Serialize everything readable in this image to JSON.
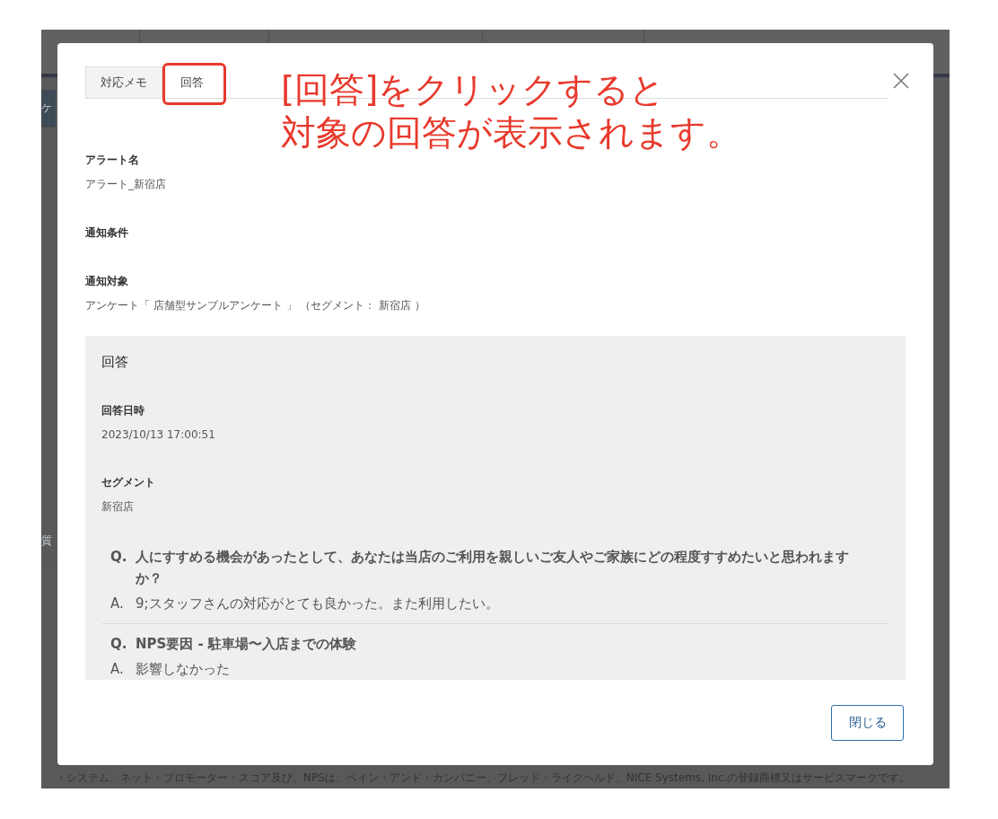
{
  "background_app": {
    "sidebar_items": [
      "ケ",
      "質"
    ],
    "footer": "・システム、ネット・プロモーター・スコア及び、NPSは、ベイン・アンド・カンパニー、フレッド・ライクヘルド、NICE Systems, Inc.の登録商標又はサービスマークです。"
  },
  "annotation": {
    "lines": [
      "[回答]をクリックすると",
      "対象の回答が表示されます。"
    ]
  },
  "modal": {
    "tabs": [
      {
        "label": "対応メモ",
        "selected": false,
        "highlighted": false
      },
      {
        "label": "回答",
        "selected": true,
        "highlighted": true
      }
    ],
    "fields": [
      {
        "label": "アラート名",
        "value": "アラート_新宿店"
      },
      {
        "label": "通知条件"
      },
      {
        "label": "通知対象",
        "value": "アンケート「 店舗型サンプルアンケート 」 （セグメント： 新宿店 ）"
      }
    ],
    "answer_panel": {
      "title": "回答",
      "fields": [
        {
          "label": "回答日時",
          "value": "2023/10/13 17:00:51"
        },
        {
          "label": "セグメント",
          "value": "新宿店"
        }
      ],
      "qa": [
        {
          "question_mark": "Q.",
          "question": "人にすすめる機会があったとして、あなたは当店のご利用を親しいご友人やご家族にどの程度すすめたいと思われますか？",
          "answer_mark": "A.",
          "answer": "9;スタッフさんの対応がとても良かった。また利用したい。"
        },
        {
          "question_mark": "Q.",
          "question": "NPS要因 - 駐車場〜入店までの体験",
          "answer_mark": "A.",
          "answer": "影響しなかった"
        }
      ]
    },
    "close_button": "閉じる"
  }
}
